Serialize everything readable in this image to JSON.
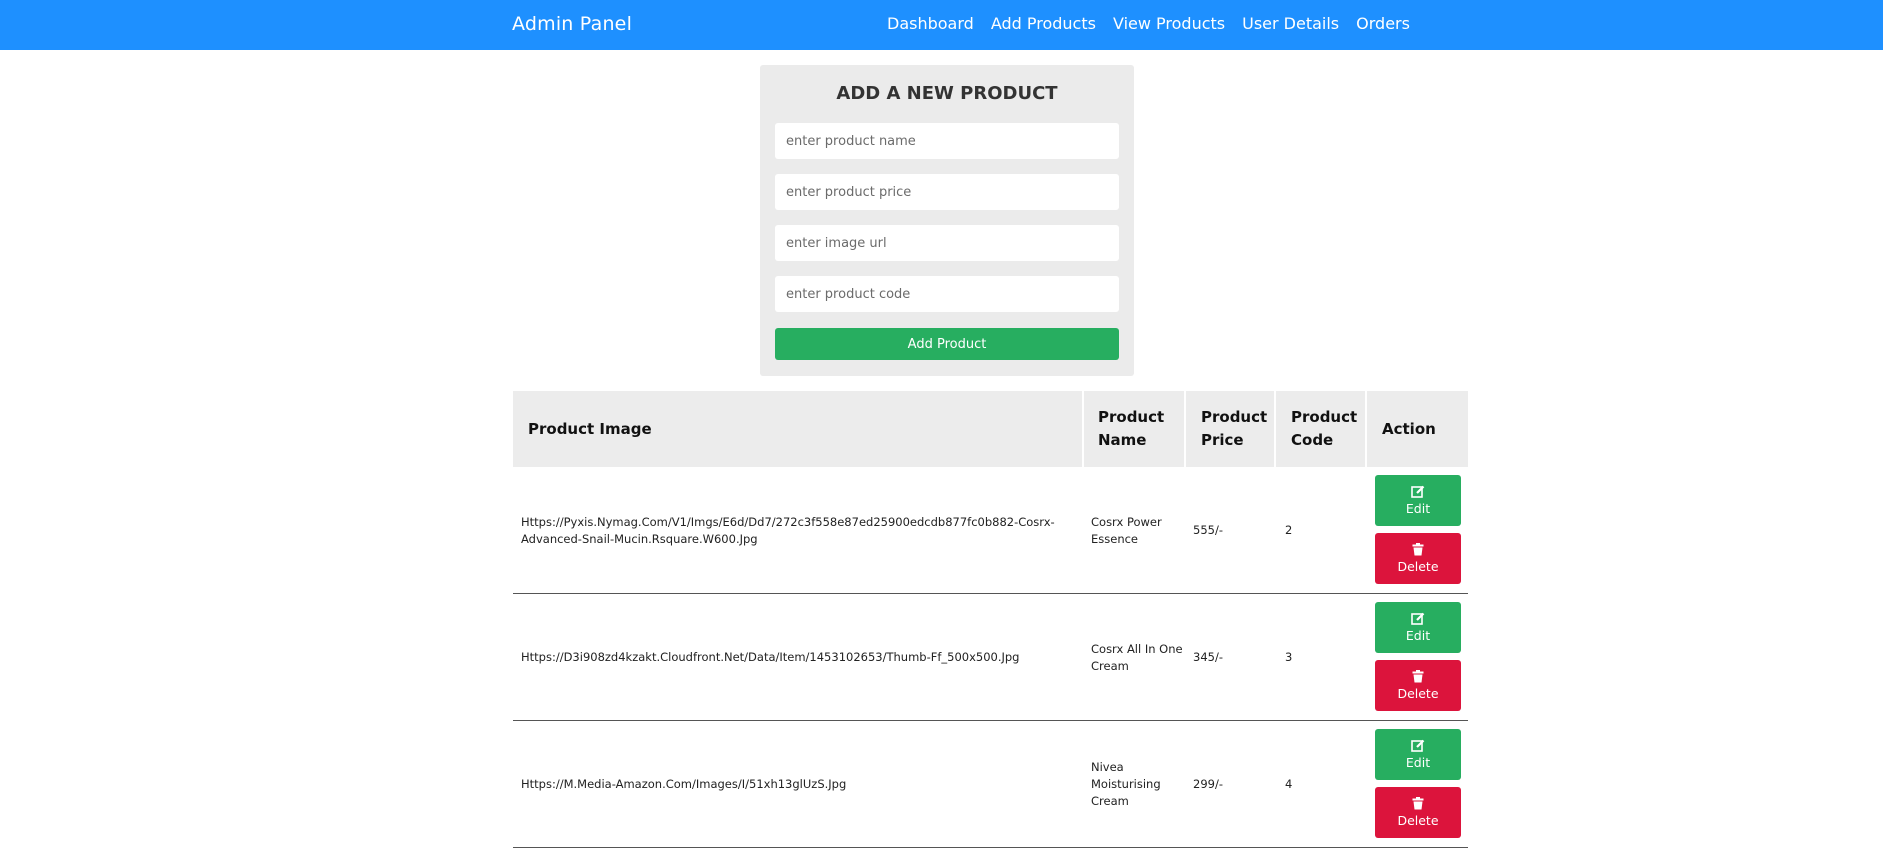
{
  "navbar": {
    "brand": "Admin Panel",
    "links": [
      "Dashboard",
      "Add Products",
      "View Products",
      "User Details",
      "Orders"
    ]
  },
  "form": {
    "title": "Add a new product",
    "name_placeholder": "enter product name",
    "price_placeholder": "enter product price",
    "image_placeholder": "enter image url",
    "code_placeholder": "enter product code",
    "submit_label": "Add Product"
  },
  "table": {
    "headers": {
      "image": "Product Image",
      "name": "Product Name",
      "price": "Product Price",
      "code": "Product Code",
      "action": "Action"
    },
    "rows": [
      {
        "image": "Https://Pyxis.Nymag.Com/V1/Imgs/E6d/Dd7/272c3f558e87ed25900edcdb877fc0b882-Cosrx-Advanced-Snail-Mucin.Rsquare.W600.Jpg",
        "name": "Cosrx Power Essence",
        "price": "555/-",
        "code": "2"
      },
      {
        "image": "Https://D3i908zd4kzakt.Cloudfront.Net/Data/Item/1453102653/Thumb-Ff_500x500.Jpg",
        "name": "Cosrx All In One Cream",
        "price": "345/-",
        "code": "3"
      },
      {
        "image": "Https://M.Media-Amazon.Com/Images/I/51xh13glUzS.Jpg",
        "name": "Nivea Moisturising Cream",
        "price": "299/-",
        "code": "4"
      }
    ],
    "edit_label": "Edit",
    "delete_label": "Delete"
  },
  "icons": {
    "edit": "edit-icon",
    "delete": "trash-icon"
  },
  "colors": {
    "navbar": "#1e90ff",
    "add_button": "#27ae60",
    "edit_button": "#27ae60",
    "delete_button": "#dc143c",
    "form_bg": "#ebebeb",
    "table_header_bg": "#ececec"
  }
}
